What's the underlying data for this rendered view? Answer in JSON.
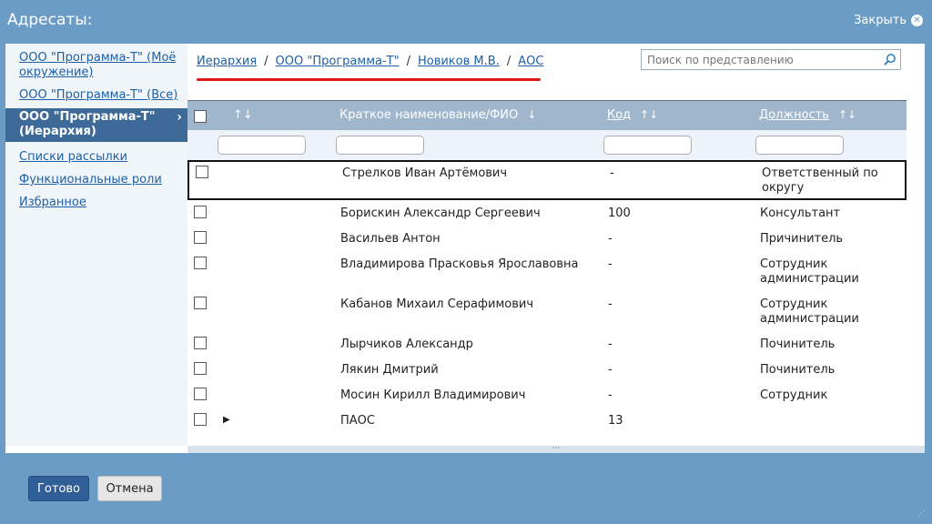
{
  "window": {
    "title": "Адресаты:",
    "close_label": "Закрыть"
  },
  "sidebar": {
    "items": [
      {
        "label": "ООО \"Программа-Т\" (Моё окружение)"
      },
      {
        "label": "ООО \"Программа-Т\" (Все)"
      },
      {
        "label": "ООО \"Программа-Т\" (Иерархия)"
      },
      {
        "label": "Списки рассылки"
      },
      {
        "label": "Функциональные роли"
      },
      {
        "label": "Избранное"
      }
    ],
    "active_index": 2
  },
  "breadcrumb": [
    "Иерархия",
    "ООО \"Программа-Т\"",
    "Новиков М.В.",
    "АОС"
  ],
  "breadcrumb_separator": "/",
  "search": {
    "placeholder": "Поиск по представлению"
  },
  "table": {
    "columns": {
      "name": "Краткое наименование/ФИО",
      "code": "Код",
      "position": "Должность"
    },
    "sort_icon": "↑↓",
    "sort_down_icon": "↓",
    "rows": [
      {
        "name": "Стрелков Иван Артёмович",
        "code": "-",
        "position": "Ответственный по округу",
        "selected": true
      },
      {
        "name": "Борискин Александр Сергеевич",
        "code": "100",
        "position": "Консультант"
      },
      {
        "name": "Васильев Антон",
        "code": "-",
        "position": "Причинитель"
      },
      {
        "name": "Владимирова Прасковья Ярославовна",
        "code": "-",
        "position": "Сотрудник администрации"
      },
      {
        "name": "Кабанов Михаил Серафимович",
        "code": "-",
        "position": "Сотрудник администрации"
      },
      {
        "name": "Лырчиков Александр",
        "code": "-",
        "position": "Починитель"
      },
      {
        "name": "Лякин Дмитрий",
        "code": "-",
        "position": "Починитель"
      },
      {
        "name": "Мосин Кирилл Владимирович",
        "code": "-",
        "position": "Сотрудник"
      },
      {
        "name": "ПАОС",
        "code": "13",
        "position": "",
        "expandable": true
      }
    ]
  },
  "buttons": {
    "ok": "Готово",
    "cancel": "Отмена"
  },
  "colors": {
    "header_bg": "#6a9cc6",
    "accent": "#2f5f96",
    "active_nav": "#3d6a98",
    "highlight_line": "#e01818"
  }
}
